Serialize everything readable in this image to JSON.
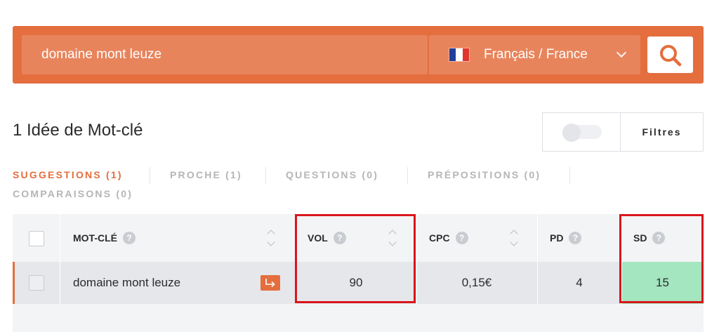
{
  "search": {
    "query": "domaine mont leuze",
    "language_label": "Français / France",
    "flag_icon": "france-flag-icon",
    "search_icon": "search-icon"
  },
  "results": {
    "title": "1 Idée de Mot-clé",
    "filter_label": "Filtres",
    "toggle_state": "off"
  },
  "tabs": [
    {
      "label": "SUGGESTIONS (1)",
      "active": true
    },
    {
      "label": "PROCHE (1)",
      "active": false
    },
    {
      "label": "QUESTIONS (0)",
      "active": false
    },
    {
      "label": "PRÉPOSITIONS (0)",
      "active": false
    },
    {
      "label": "COMPARAISONS (0)",
      "active": false
    }
  ],
  "table": {
    "columns": [
      {
        "key": "keyword",
        "label": "MOT-CLÉ",
        "help": "?"
      },
      {
        "key": "vol",
        "label": "VOL",
        "help": "?"
      },
      {
        "key": "cpc",
        "label": "CPC",
        "help": "?"
      },
      {
        "key": "pd",
        "label": "PD",
        "help": "?"
      },
      {
        "key": "sd",
        "label": "SD",
        "help": "?"
      }
    ],
    "rows": [
      {
        "keyword": "domaine mont leuze",
        "vol": "90",
        "cpc": "0,15€",
        "pd": "4",
        "sd": "15"
      }
    ]
  },
  "colors": {
    "accent": "#e46e3e",
    "sd_good": "#a3e6c0",
    "highlight": "#d9161c"
  }
}
